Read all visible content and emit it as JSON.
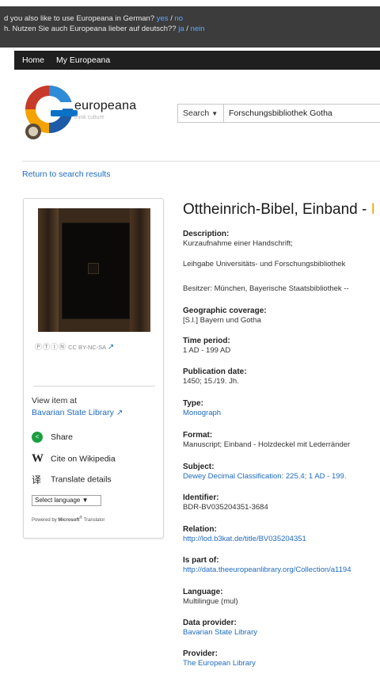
{
  "lang_banner": {
    "line1_text": "d you also like to use Europeana in German?",
    "line1_yes": "yes",
    "line1_sep": "/",
    "line1_no": "no",
    "line2_text": "h. Nutzen Sie auch Europeana lieber auf deutsch??",
    "line2_yes": "ja",
    "line2_sep": "/",
    "line2_no": "nein"
  },
  "nav": {
    "home": "Home",
    "my_europeana": "My Europeana"
  },
  "logo": {
    "name": "europeana",
    "tagline": "think culture"
  },
  "search": {
    "type_label": "Search",
    "query": "Forschungsbibliothek Gotha"
  },
  "return_link": "Return to search results",
  "sidebar": {
    "license": "CC BY-NC-SA",
    "view_item_at": "View item at",
    "provider_link": "Bavarian State Library",
    "share": "Share",
    "cite": "Cite on Wikipedia",
    "translate": "Translate details",
    "select_language": "Select language",
    "powered_prefix": "Powered by",
    "powered_brand": "Microsoft",
    "powered_suffix": "Translator"
  },
  "record": {
    "title": "Ottheinrich-Bibel, Einband - ",
    "title_accent": "I",
    "fields": {
      "description_label": "Description:",
      "description_1": "Kurzaufnahme einer Handschrift;",
      "description_2": "Leihgabe Universitäts- und Forschungsbibliothek",
      "description_3": "Besitzer: München, Bayerische Staatsbibliothek --",
      "geo_label": "Geographic coverage:",
      "geo_value": "[S.l.] Bayern und Gotha",
      "time_label": "Time period:",
      "time_value": "1 AD - 199 AD",
      "pubdate_label": "Publication date:",
      "pubdate_value": "1450; 15./19. Jh.",
      "type_label": "Type:",
      "type_value": "Monograph",
      "format_label": "Format:",
      "format_value": "Manuscript; Einband - Holzdeckel mit Lederränder",
      "subject_label": "Subject:",
      "subject_value": "Dewey Decimal Classification: 225.4; 1 AD - 199.",
      "identifier_label": "Identifier:",
      "identifier_value": "BDR-BV035204351-3684",
      "relation_label": "Relation:",
      "relation_value": "http://lod.b3kat.de/title/BV035204351",
      "ispartof_label": "Is part of:",
      "ispartof_value": "http://data.theeuropeanlibrary.org/Collection/a1194",
      "language_label": "Language:",
      "language_value": "Multilingue (mul)",
      "dataprovider_label": "Data provider:",
      "dataprovider_value": "Bavarian State Library",
      "provider_label": "Provider:",
      "provider_value": "The European Library"
    }
  },
  "colors": {
    "link": "#1f6bbf",
    "banner_bg": "#3c3c3c",
    "navbar_bg": "#1f1f1f",
    "share_green": "#1a9f43",
    "title_accent": "#e8a700"
  }
}
